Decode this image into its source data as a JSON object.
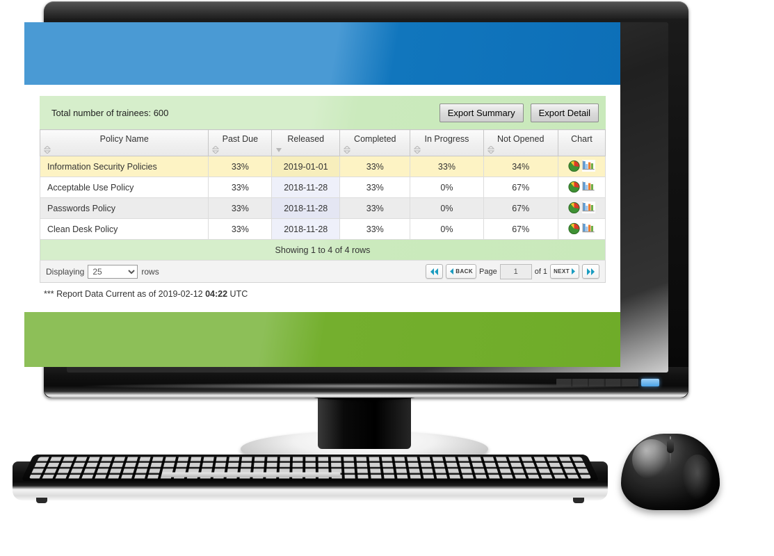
{
  "report": {
    "toolbar": {
      "total_trainees_label": "Total number of trainees: 600",
      "export_summary_label": "Export Summary",
      "export_detail_label": "Export Detail"
    },
    "columns": [
      {
        "label": "Policy Name",
        "sort": "none"
      },
      {
        "label": "Past Due",
        "sort": "none"
      },
      {
        "label": "Released",
        "sort": "desc"
      },
      {
        "label": "Completed",
        "sort": "none"
      },
      {
        "label": "In Progress",
        "sort": "none"
      },
      {
        "label": "Not Opened",
        "sort": "none"
      },
      {
        "label": "Chart",
        "sort": "nosort"
      }
    ],
    "rows": [
      {
        "policy": "Information Security Policies",
        "past_due": "33%",
        "released": "2019-01-01",
        "completed": "33%",
        "in_progress": "33%",
        "not_opened": "34%"
      },
      {
        "policy": "Acceptable Use Policy",
        "past_due": "33%",
        "released": "2018-11-28",
        "completed": "33%",
        "in_progress": "0%",
        "not_opened": "67%"
      },
      {
        "policy": "Passwords Policy",
        "past_due": "33%",
        "released": "2018-11-28",
        "completed": "33%",
        "in_progress": "0%",
        "not_opened": "67%"
      },
      {
        "policy": "Clean Desk Policy",
        "past_due": "33%",
        "released": "2018-11-28",
        "completed": "33%",
        "in_progress": "0%",
        "not_opened": "67%"
      }
    ],
    "showing_label": "Showing 1 to 4 of 4 rows",
    "pager": {
      "displaying_label": "Displaying",
      "rows_label": "rows",
      "rows_per_page_selected": "25",
      "rows_per_page_options": [
        "25"
      ],
      "first_label": "",
      "back_label": "BACK",
      "page_label": "Page",
      "page_value": "1",
      "of_label": "of 1",
      "next_label": "NEXT",
      "last_label": ""
    },
    "footnote_prefix": "*** Report Data Current as of 2019-02-12 ",
    "footnote_time": "04:22",
    "footnote_suffix": " UTC"
  },
  "colors": {
    "banner_blue_light": "#4a9ad4",
    "banner_blue_dark": "#0d6fb8",
    "banner_green_light": "#8dbf58",
    "banner_green_dark": "#6fac29",
    "toolbar_green": "#d6eecb",
    "link_blue": "#2a7fd4",
    "row_highlight": "#fdf3c4",
    "row_alt": "#ececec",
    "sorted_column": "#eef0fa"
  }
}
